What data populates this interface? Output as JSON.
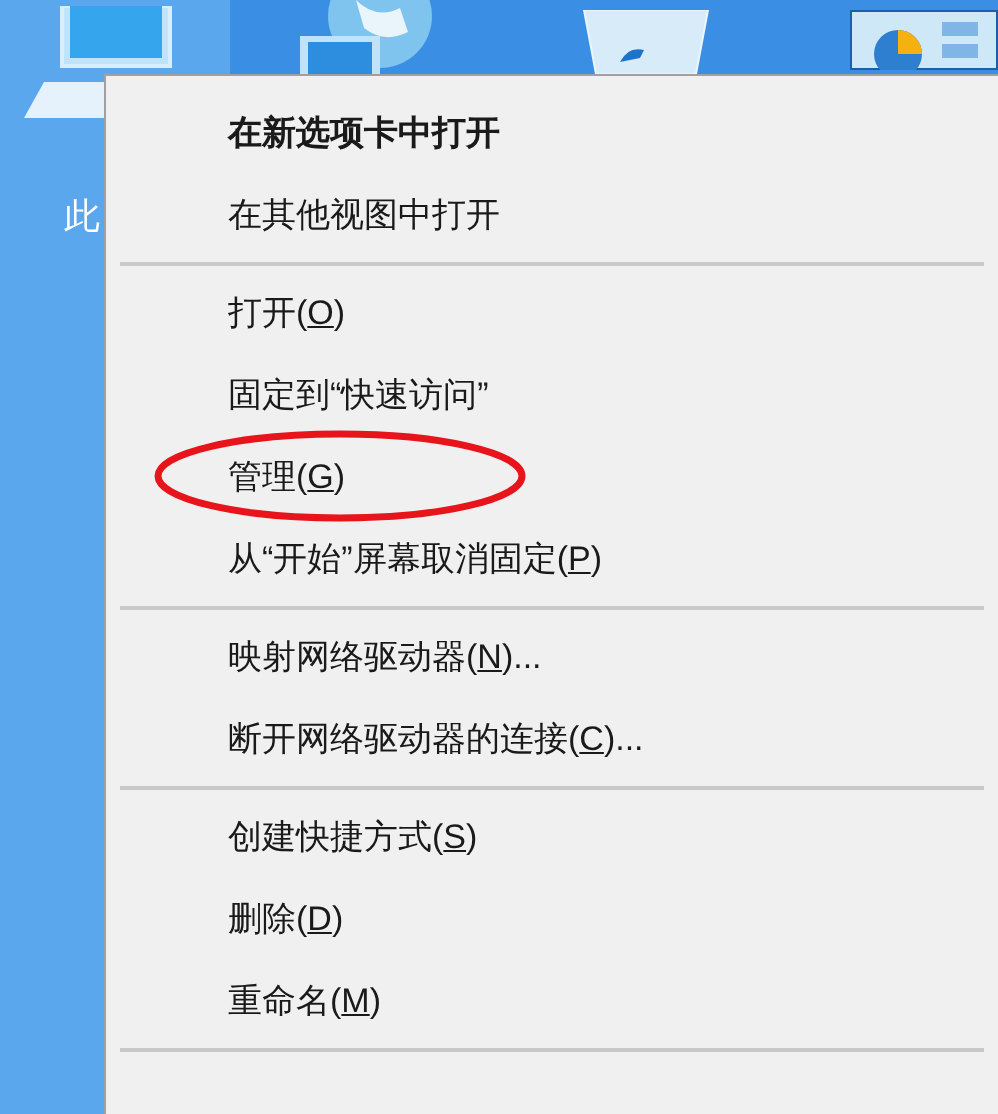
{
  "desktop": {
    "icon_label": "此"
  },
  "menu": {
    "groups": [
      [
        {
          "text": "在新选项卡中打开",
          "default": true,
          "circled": false
        },
        {
          "text": "在其他视图中打开",
          "default": false,
          "circled": false
        }
      ],
      [
        {
          "text": "打开(",
          "key": "O",
          "suffix": ")",
          "default": false,
          "circled": false
        },
        {
          "text": "固定到“快速访问”",
          "default": false,
          "circled": false
        },
        {
          "text": "管理(",
          "key": "G",
          "suffix": ")",
          "default": false,
          "circled": true
        },
        {
          "text": "从“开始”屏幕取消固定(",
          "key": "P",
          "suffix": ")",
          "default": false,
          "circled": false
        }
      ],
      [
        {
          "text": "映射网络驱动器(",
          "key": "N",
          "suffix": ")...",
          "default": false,
          "circled": false
        },
        {
          "text": "断开网络驱动器的连接(",
          "key": "C",
          "suffix": ")...",
          "default": false,
          "circled": false
        }
      ],
      [
        {
          "text": "创建快捷方式(",
          "key": "S",
          "suffix": ")",
          "default": false,
          "circled": false
        },
        {
          "text": "删除(",
          "key": "D",
          "suffix": ")",
          "default": false,
          "circled": false
        },
        {
          "text": "重命名(",
          "key": "M",
          "suffix": ")",
          "default": false,
          "circled": false
        }
      ]
    ]
  }
}
